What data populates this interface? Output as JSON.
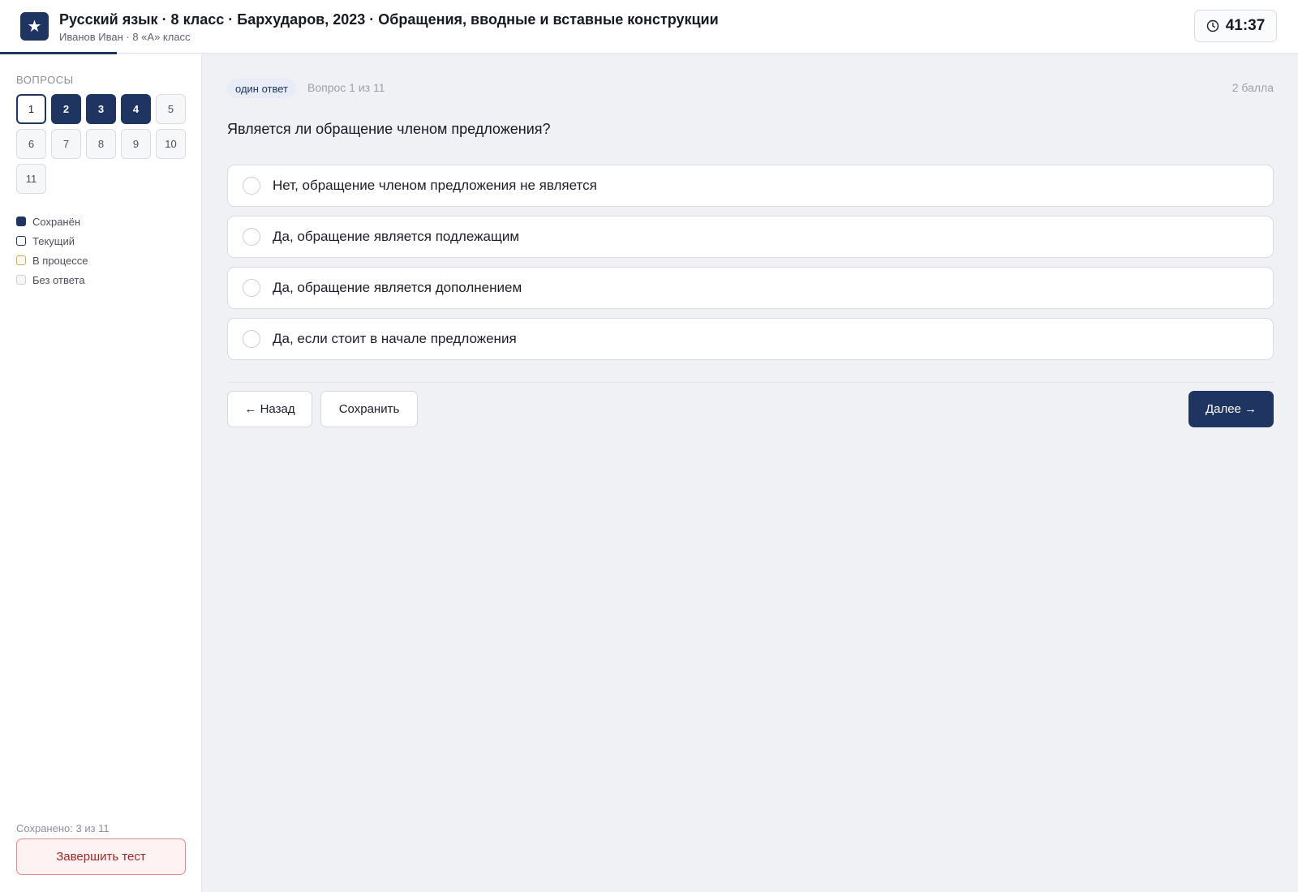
{
  "header": {
    "logo_glyph": "★",
    "title": "Русский язык · 8 класс · Бархударов, 2023 · Обращения, вводные и вставные конструкции",
    "subtitle": "Иванов Иван · 8 «А» класс",
    "timer": "41:37",
    "progress_fraction": 0.09
  },
  "sidebar": {
    "label": "ВОПРОСЫ",
    "questions": [
      {
        "label": "1",
        "state": "current"
      },
      {
        "label": "2",
        "state": "saved"
      },
      {
        "label": "3",
        "state": "saved"
      },
      {
        "label": "4",
        "state": "saved"
      },
      {
        "label": "5",
        "state": "none"
      },
      {
        "label": "6",
        "state": "none"
      },
      {
        "label": "7",
        "state": "none"
      },
      {
        "label": "8",
        "state": "none"
      },
      {
        "label": "9",
        "state": "none"
      },
      {
        "label": "10",
        "state": "none"
      },
      {
        "label": "11",
        "state": "none"
      }
    ],
    "legend": {
      "saved": "Сохранён",
      "current": "Текущий",
      "in_progress": "В процессе",
      "no_answer": "Без ответа"
    },
    "saved_count": "Сохранено: 3 из 11",
    "finish_label": "Завершить тест"
  },
  "main": {
    "type_badge": "один ответ",
    "counter": "Вопрос 1 из 11",
    "points": "2 балла",
    "question": "Является ли обращение членом предложения?",
    "options": [
      "Нет, обращение членом предложения не является",
      "Да, обращение является подлежащим",
      "Да, обращение является дополнением",
      "Да, если стоит в начале предложения"
    ],
    "back_label": "← Назад",
    "save_label": "Сохранить",
    "next_label": "Далее →"
  },
  "colors": {
    "accent": "#1e3461",
    "in_progress": "#e0a93a",
    "danger": "#a02828"
  }
}
